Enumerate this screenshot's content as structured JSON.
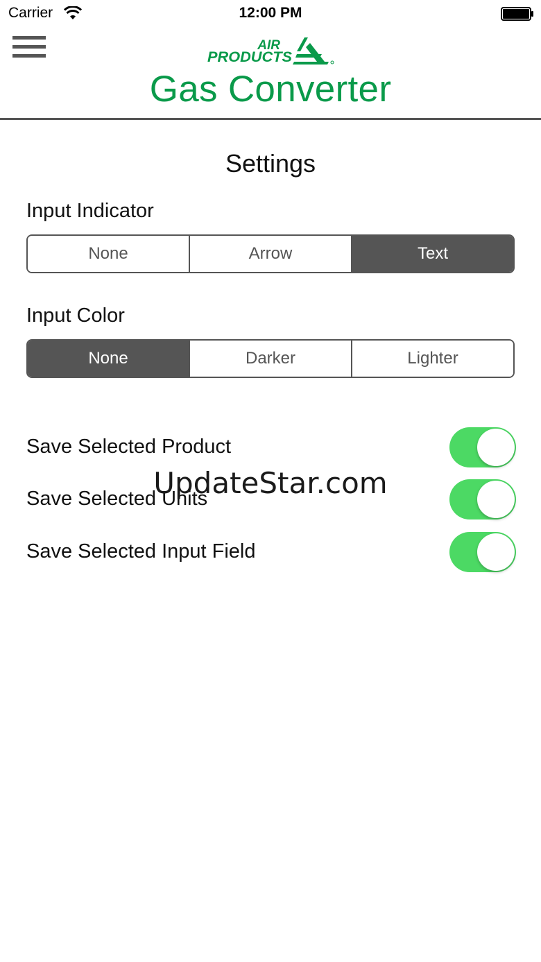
{
  "status_bar": {
    "carrier": "Carrier",
    "time": "12:00 PM"
  },
  "header": {
    "logo_line1": "AIR",
    "logo_line2": "PRODUCTS",
    "title": "Gas Converter",
    "menu_icon": "hamburger-menu-icon"
  },
  "page_title": "Settings",
  "input_indicator": {
    "label": "Input Indicator",
    "options": [
      "None",
      "Arrow",
      "Text"
    ],
    "selected": "Text"
  },
  "input_color": {
    "label": "Input Color",
    "options": [
      "None",
      "Darker",
      "Lighter"
    ],
    "selected": "None"
  },
  "toggles": [
    {
      "label": "Save Selected Product",
      "on": true
    },
    {
      "label": "Save Selected Units",
      "on": true
    },
    {
      "label": "Save Selected Input Field",
      "on": true
    }
  ],
  "watermark": "UpdateStar.com",
  "colors": {
    "brand_green": "#0a9a4a",
    "toggle_on": "#4cd964",
    "segment_dark": "#555555"
  }
}
